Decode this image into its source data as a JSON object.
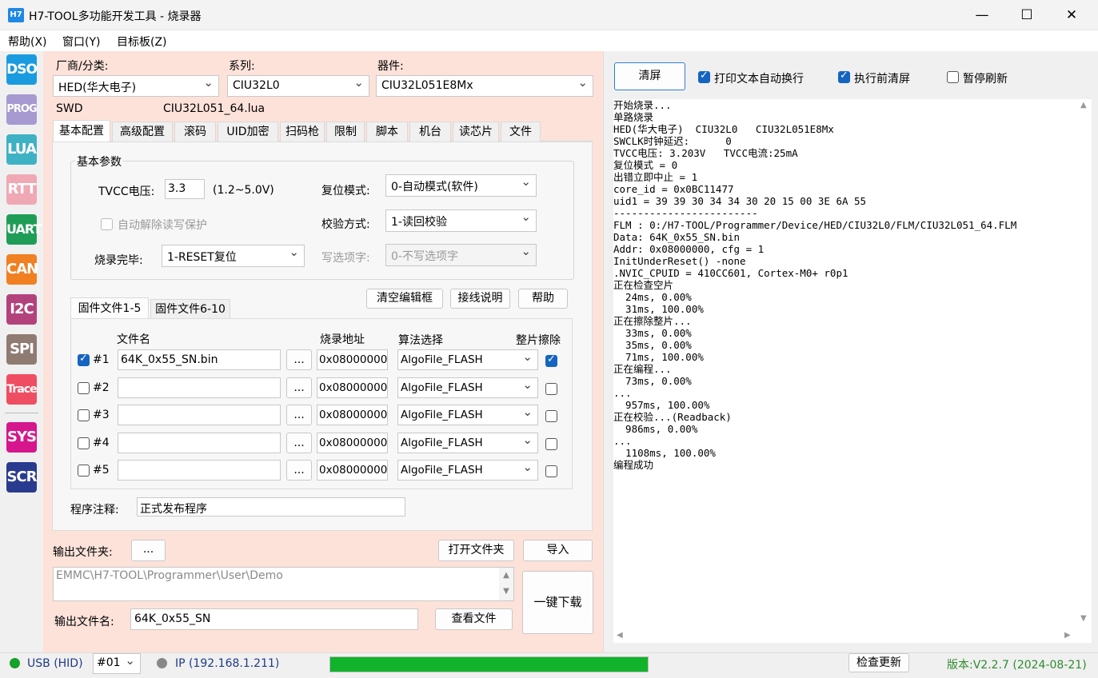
{
  "window": {
    "icon_text": "H7",
    "title": "H7-TOOL多功能开发工具 - 烧录器",
    "minimize": "—",
    "maximize": "☐",
    "close": "✕"
  },
  "menu": [
    "帮助(X)",
    "窗口(Y)",
    "目标板(Z)"
  ],
  "sidebar": [
    {
      "label": "DSO",
      "color": "#1a9be0"
    },
    {
      "label": "PROG",
      "color": "#a69ad0"
    },
    {
      "label": "LUA",
      "color": "#3fb1c4"
    },
    {
      "label": "RTT",
      "color": "#f0a8b4"
    },
    {
      "label": "UART",
      "color": "#1f9d57"
    },
    {
      "label": "CAN",
      "color": "#f08021"
    },
    {
      "label": "I2C",
      "color": "#b3427c"
    },
    {
      "label": "SPI",
      "color": "#8f7b72"
    },
    {
      "label": "Trace",
      "color": "#ef4e62"
    },
    {
      "label": "SYS",
      "color": "#d6168c"
    },
    {
      "label": "SCR",
      "color": "#283b8f"
    }
  ],
  "device": {
    "vendor_label": "厂商/分类:",
    "vendor_value": "HED(华大电子)",
    "series_label": "系列:",
    "series_value": "CIU32L0",
    "chip_label": "器件:",
    "chip_value": "CIU32L051E8Mx",
    "interface": "SWD",
    "lua_file": "CIU32L051_64.lua"
  },
  "tabs": [
    "基本配置",
    "高级配置",
    "滚码",
    "UID加密",
    "扫码枪",
    "限制",
    "脚本",
    "机台",
    "读芯片",
    "文件"
  ],
  "basic": {
    "group_title": "基本参数",
    "tvcc_label": "TVCC电压:",
    "tvcc_value": "3.3",
    "tvcc_range": "(1.2~5.0V)",
    "reset_label": "复位模式:",
    "reset_value": "0-自动模式(软件)",
    "auto_unlock_label": "自动解除读写保护",
    "verify_label": "校验方式:",
    "verify_value": "1-读回校验",
    "done_label": "烧录完毕:",
    "done_value": "1-RESET复位",
    "option_label": "写选项字:",
    "option_value": "0-不写选项字"
  },
  "actions": {
    "clear_edit": "清空编辑框",
    "wiring": "接线说明",
    "help": "帮助"
  },
  "file_tabs": [
    "固件文件1-5",
    "固件文件6-10"
  ],
  "file_table": {
    "headers": {
      "name": "文件名",
      "addr": "烧录地址",
      "algo": "算法选择",
      "erase": "整片擦除"
    },
    "browse": "...",
    "rows": [
      {
        "checked": true,
        "num": "#1",
        "file": "64K_0x55_SN.bin",
        "addr": "0x08000000",
        "algo": "AlgoFile_FLASH",
        "erase": true
      },
      {
        "checked": false,
        "num": "#2",
        "file": "",
        "addr": "0x08000000",
        "algo": "AlgoFile_FLASH",
        "erase": false
      },
      {
        "checked": false,
        "num": "#3",
        "file": "",
        "addr": "0x08000000",
        "algo": "AlgoFile_FLASH",
        "erase": false
      },
      {
        "checked": false,
        "num": "#4",
        "file": "",
        "addr": "0x08000000",
        "algo": "AlgoFile_FLASH",
        "erase": false
      },
      {
        "checked": false,
        "num": "#5",
        "file": "",
        "addr": "0x08000000",
        "algo": "AlgoFile_FLASH",
        "erase": false
      }
    ]
  },
  "comment": {
    "label": "程序注释:",
    "value": "正式发布程序"
  },
  "output": {
    "folder_label": "输出文件夹:",
    "folder_browse": "...",
    "open_folder": "打开文件夹",
    "import": "导入",
    "path": "EMMC\\H7-TOOL\\Programmer\\User\\Demo",
    "name_label": "输出文件名:",
    "name_value": "64K_0x55_SN",
    "view_file": "查看文件",
    "download": "一键下载"
  },
  "right": {
    "clear": "清屏",
    "wrap_label": "打印文本自动换行",
    "clear_before_label": "执行前清屏",
    "pause_label": "暂停刷新"
  },
  "log": [
    "开始烧录...",
    "单路烧录",
    "HED(华大电子)  CIU32L0   CIU32L051E8Mx",
    "SWCLK时钟延迟:      0",
    "TVCC电压: 3.203V   TVCC电流:25mA",
    "复位模式 = 0",
    "出错立即中止 = 1",
    "core_id = 0x0BC11477",
    "uid1 = 39 39 30 34 34 30 20 15 00 3E 6A 55",
    "------------------------",
    "FLM : 0:/H7-TOOL/Programmer/Device/HED/CIU32L0/FLM/CIU32L051_64.FLM",
    "Data: 64K_0x55_SN.bin",
    "Addr: 0x08000000, cfg = 1",
    "InitUnderReset() -none",
    ".NVIC_CPUID = 410CC601, Cortex-M0+ r0p1",
    "正在检查空片",
    "  24ms, 0.00%",
    "  31ms, 100.00%",
    "正在擦除整片...",
    "  33ms, 0.00%",
    "  35ms, 0.00%",
    "  71ms, 100.00%",
    "正在编程...",
    "  73ms, 0.00%",
    "...",
    "  957ms, 100.00%",
    "正在校验...(Readback)",
    "  986ms, 0.00%",
    "...",
    "  1108ms, 100.00%",
    "编程成功"
  ],
  "status": {
    "usb": "USB (HID)",
    "port": "#01",
    "ip": "IP (192.168.1.211)",
    "progress": 1.0,
    "check_update": "检查更新",
    "version": "版本:V2.2.7 (2024-08-21)"
  }
}
